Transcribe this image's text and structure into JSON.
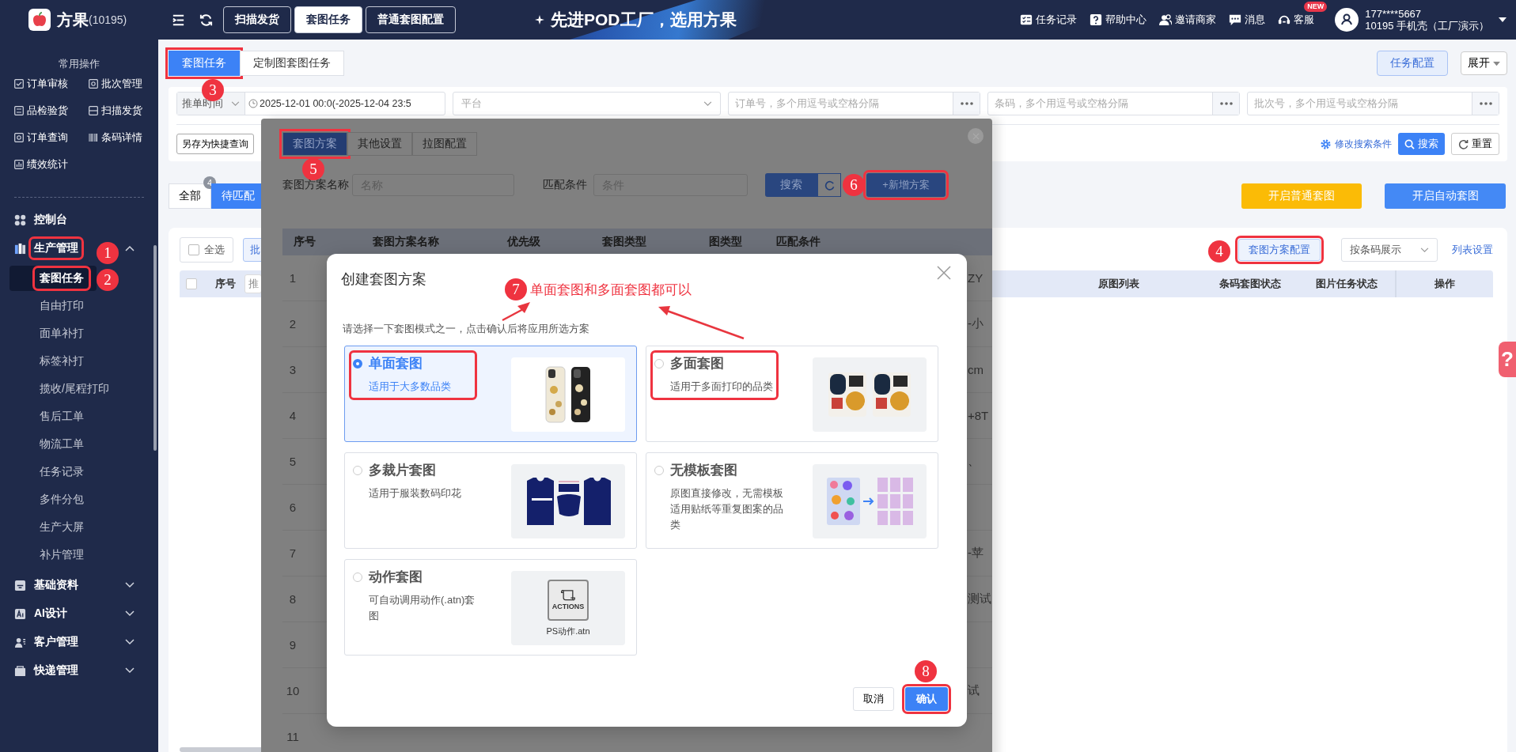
{
  "topbar": {
    "brand": "方果",
    "brand_id": "(10195)",
    "nav": [
      {
        "label": "扫描发货",
        "selected": false
      },
      {
        "label": "套图任务",
        "selected": true
      },
      {
        "label": "普通套图配置",
        "selected": false
      }
    ],
    "banner": "先进POD工厂，选用方果",
    "links": [
      {
        "label": "任务记录",
        "kind": "tasks"
      },
      {
        "label": "帮助中心",
        "kind": "help"
      },
      {
        "label": "邀请商家",
        "kind": "invite"
      },
      {
        "label": "消息",
        "kind": "message"
      },
      {
        "label": "客服",
        "kind": "support",
        "badge": "NEW"
      }
    ],
    "user": {
      "phone": "177****5667",
      "account": "10195  手机壳（工厂演示）"
    }
  },
  "sidebar": {
    "quick_title": "常用操作",
    "quick": [
      {
        "label": "订单审核",
        "kind": "check"
      },
      {
        "label": "批次管理",
        "kind": "batch"
      },
      {
        "label": "品检验货",
        "kind": "inspect"
      },
      {
        "label": "扫描发货",
        "kind": "scan"
      },
      {
        "label": "订单查询",
        "kind": "query"
      },
      {
        "label": "条码详情",
        "kind": "barcode"
      },
      {
        "label": "绩效统计",
        "kind": "stats"
      }
    ],
    "menu": [
      {
        "label": "控制台",
        "kind": "dashboard",
        "highlighted": false
      },
      {
        "label": "生产管理",
        "kind": "production",
        "expanded": true,
        "highlighted": true,
        "marker": "1",
        "children": [
          {
            "label": "套图任务",
            "selected": true,
            "highlighted": true,
            "marker": "2"
          },
          {
            "label": "自由打印",
            "selected": false,
            "highlighted": false
          },
          {
            "label": "面单补打",
            "selected": false,
            "highlighted": false
          },
          {
            "label": "标签补打",
            "selected": false,
            "highlighted": false
          },
          {
            "label": "揽收/尾程打印",
            "selected": false,
            "highlighted": false
          },
          {
            "label": "售后工单",
            "selected": false,
            "highlighted": false
          },
          {
            "label": "物流工单",
            "selected": false,
            "highlighted": false
          },
          {
            "label": "任务记录",
            "selected": false,
            "highlighted": false
          },
          {
            "label": "多件分包",
            "selected": false,
            "highlighted": false
          },
          {
            "label": "生产大屏",
            "selected": false,
            "highlighted": false
          },
          {
            "label": "补片管理",
            "selected": false,
            "highlighted": false
          }
        ]
      },
      {
        "label": "基础资料",
        "kind": "basics",
        "expanded": false,
        "highlighted": false
      },
      {
        "label": "AI设计",
        "kind": "ai",
        "expanded": false,
        "highlighted": false
      },
      {
        "label": "客户管理",
        "kind": "customers",
        "expanded": false,
        "highlighted": false
      },
      {
        "label": "快递管理",
        "kind": "express",
        "expanded": false,
        "highlighted": false
      }
    ]
  },
  "main": {
    "tabs": [
      {
        "label": "套图任务",
        "selected": true,
        "highlighted": true,
        "marker": "3"
      },
      {
        "label": "定制图套图任务",
        "selected": false,
        "highlighted": false
      }
    ],
    "task_config_button": "任务配置",
    "expand_button": "展开",
    "filters": {
      "time_field": "推单时间",
      "date_range": "2025-12-01 00:0(-2025-12-04 23:5",
      "platform": {
        "placeholder": "平台"
      },
      "inputs": [
        {
          "placeholder": "订单号，多个用逗号或空格分隔"
        },
        {
          "placeholder": "条码，多个用逗号或空格分隔"
        },
        {
          "placeholder": "批次号，多个用逗号或空格分隔"
        }
      ],
      "save_query_button": "另存为快捷查询",
      "edit_conditions_link": "修改搜索条件",
      "search_button": "搜索",
      "reset_button": "重置"
    },
    "status_tabs": [
      {
        "label": "全部",
        "selected": false,
        "badge": "4"
      },
      {
        "label": "待匹配",
        "selected": true
      }
    ],
    "start_normal_button": "开启普通套图",
    "start_auto_button": "开启自动套图",
    "table": {
      "select_all": {
        "label": "全选",
        "checked": false
      },
      "batch_button": "批",
      "scheme_config_button": {
        "label": "套图方案配置",
        "highlighted": true,
        "marker": "4"
      },
      "display_mode": "按条码展示",
      "list_settings_link": "列表设置",
      "header_checkbox": {
        "checked": false
      },
      "columns_left": [
        "序号",
        "推"
      ],
      "columns_right": [
        "原图列表",
        "条码套图状态",
        "图片任务状态",
        "操作"
      ]
    }
  },
  "scheme_dialog": {
    "tabs": [
      {
        "label": "套图方案",
        "selected": true,
        "highlighted": true,
        "marker": "5"
      },
      {
        "label": "其他设置",
        "selected": false,
        "highlighted": false
      },
      {
        "label": "拉图配置",
        "selected": false,
        "highlighted": false
      }
    ],
    "name_label": "套图方案名称",
    "name_field": {
      "placeholder": "名称"
    },
    "condition_label": "匹配条件",
    "condition_field": {
      "placeholder": "条件"
    },
    "search_button": "搜索",
    "new_button": {
      "label": "+新增方案",
      "highlighted": true,
      "marker": "6"
    },
    "columns": [
      "序号",
      "套图方案名称",
      "优先级",
      "套图类型",
      "图类型",
      "匹配条件"
    ],
    "rows": [
      {
        "index": "1",
        "condition": "ZY"
      },
      {
        "index": "2",
        "condition": "-小"
      },
      {
        "index": "3",
        "condition": "cm"
      },
      {
        "index": "4",
        "condition": "+8T"
      },
      {
        "index": "5",
        "condition": "、"
      },
      {
        "index": "6"
      },
      {
        "index": "7",
        "condition": "-苹"
      },
      {
        "index": "8",
        "condition": "测试"
      },
      {
        "index": "9"
      },
      {
        "index": "10",
        "condition": "试"
      },
      {
        "index": "11"
      }
    ]
  },
  "create_dialog": {
    "title": "创建套图方案",
    "callout": {
      "marker": "7",
      "text": "单面套图和多面套图都可以"
    },
    "subtitle": "请选择一下套图模式之一，点击确认后将应用所选方案",
    "options": [
      {
        "title": "单面套图",
        "description": "适用于大多数品类",
        "selected": true,
        "highlighted": true,
        "kind": "phone-cases"
      },
      {
        "title": "多面套图",
        "description": "适用于多面打印的品类",
        "selected": false,
        "highlighted": true,
        "kind": "pillows"
      },
      {
        "title": "多裁片套图",
        "description": "适用于服装数码印花",
        "selected": false,
        "highlighted": false,
        "kind": "vests"
      },
      {
        "title": "无模板套图",
        "description": "原图直接修改，无需模板适用贴纸等重复图案的品类",
        "selected": false,
        "highlighted": false,
        "kind": "stickers"
      },
      {
        "title": "动作套图",
        "description": "可自动调用动作(.atn)套图",
        "selected": false,
        "highlighted": false,
        "kind": "actions",
        "image_label": "ACTIONS",
        "image_caption": "PS动作.atn"
      }
    ],
    "cancel_button": "取消",
    "confirm_button": {
      "label": "确认",
      "highlighted": true,
      "marker": "8"
    }
  },
  "help_tab": "?"
}
